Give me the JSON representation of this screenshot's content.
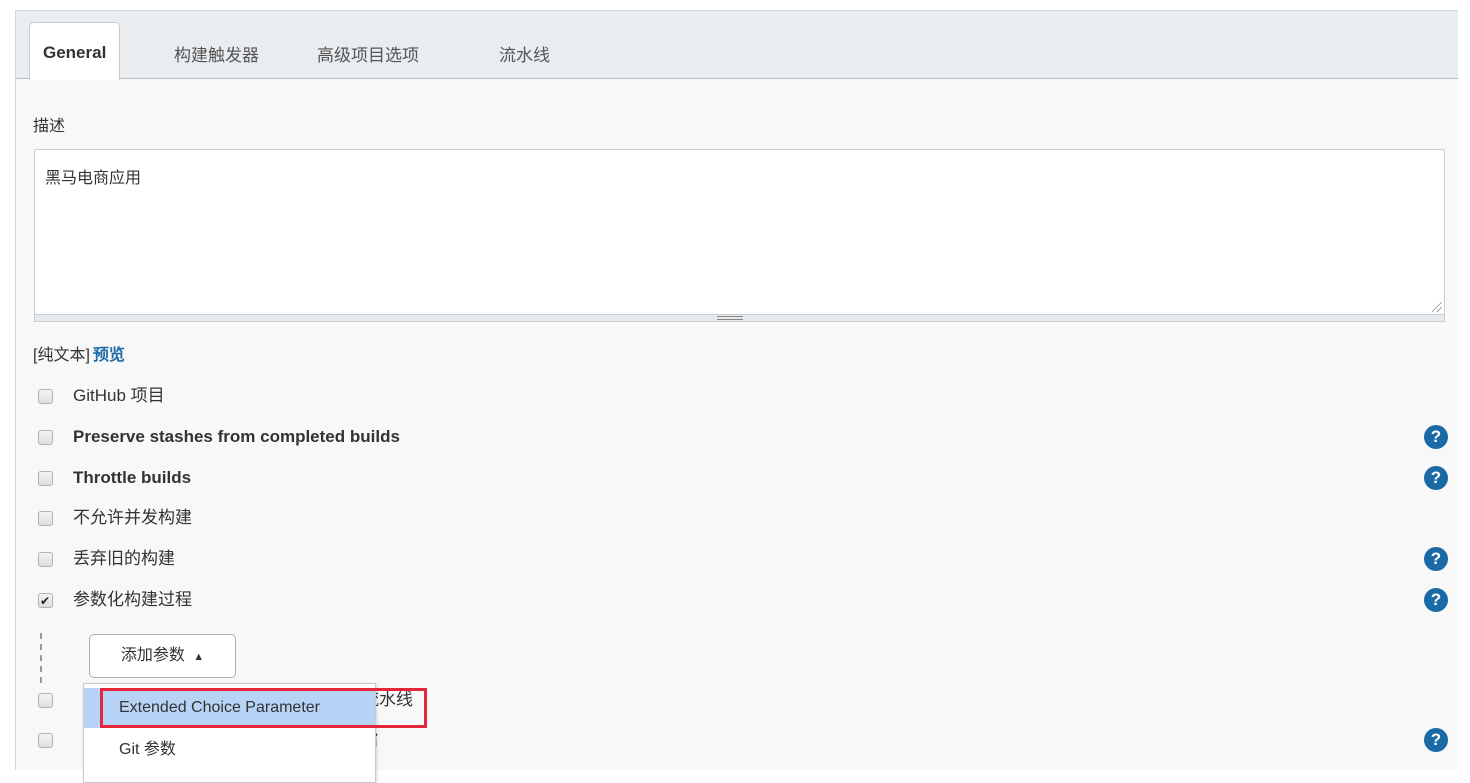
{
  "tabs": [
    {
      "label": "General",
      "active": true
    },
    {
      "label": "构建触发器",
      "active": false
    },
    {
      "label": "高级项目选项",
      "active": false
    },
    {
      "label": "流水线",
      "active": false
    }
  ],
  "description": {
    "label": "描述",
    "value": "黑马电商应用",
    "format_label": "[纯文本]",
    "preview_link": "预览"
  },
  "options": [
    {
      "label": "GitHub 项目",
      "checked": false,
      "bold": false,
      "help": false
    },
    {
      "label": "Preserve stashes from completed builds",
      "checked": false,
      "bold": true,
      "help": true
    },
    {
      "label": "Throttle builds",
      "checked": false,
      "bold": true,
      "help": true
    },
    {
      "label": "不允许并发构建",
      "checked": false,
      "bold": false,
      "help": false
    },
    {
      "label": "丢弃旧的构建",
      "checked": false,
      "bold": false,
      "help": true
    },
    {
      "label": "参数化构建过程",
      "checked": true,
      "bold": false,
      "help": true
    },
    {
      "label": "流水线",
      "checked": false,
      "bold": false,
      "help": false
    },
    {
      "label": "旨",
      "checked": false,
      "bold": false,
      "help": true
    }
  ],
  "add_param": {
    "button_label": "添加参数",
    "arrow": "▲",
    "menu": [
      {
        "label": "Extended Choice Parameter",
        "highlighted": true
      },
      {
        "label": "Git 参数",
        "highlighted": false
      }
    ]
  },
  "help_glyph": "?",
  "colors": {
    "accent": "#1a6aa6",
    "highlight": "#b7d3f5",
    "annotation_border": "#e3263a"
  }
}
